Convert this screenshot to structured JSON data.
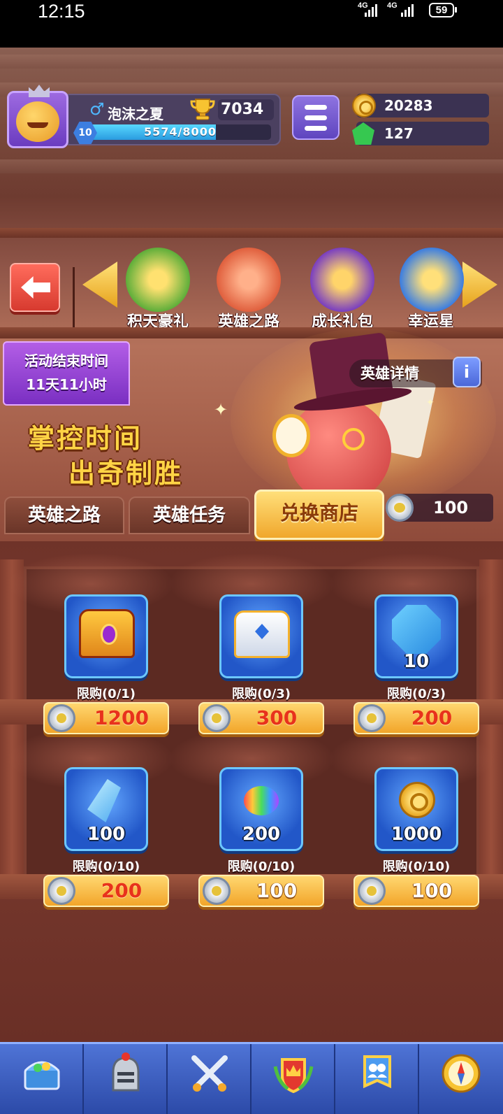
{
  "status_bar": {
    "time": "12:15",
    "network_1": "4G",
    "network_2": "4G",
    "battery": "59"
  },
  "profile": {
    "name": "泡沫之夏",
    "trophies": "7034",
    "level": "10",
    "xp_text": "5574/8000",
    "xp_progress": 0.697
  },
  "currencies": {
    "gold": "20283",
    "gems": "127"
  },
  "events": [
    {
      "label": "积天豪礼",
      "icon": "lucky-seven-icon",
      "color": "#5fae3a"
    },
    {
      "label": "英雄之路",
      "icon": "hero-clock-icon",
      "color": "#e0603e"
    },
    {
      "label": "成长礼包",
      "icon": "treasure-bag-icon",
      "color": "#7a3fc0"
    },
    {
      "label": "幸运星",
      "icon": "lucky-star-icon",
      "color": "#3c7ee0"
    }
  ],
  "banner": {
    "timer_line1": "活动结束时间",
    "timer_line2": "11天11小时",
    "slogan_line1": "掌控时间",
    "slogan_line2": "出奇制胜",
    "hero_details": "英雄详情",
    "info_glyph": "i"
  },
  "tabs": [
    {
      "label": "英雄之路"
    },
    {
      "label": "英雄任务"
    },
    {
      "label": "兑换商店",
      "active": true
    }
  ],
  "token_balance": "100",
  "shop_items": [
    {
      "icon": "golden-chest-icon",
      "qty": "",
      "limit": "限购(0/1)",
      "price": "1200",
      "price_color": "red"
    },
    {
      "icon": "winged-chest-icon",
      "qty": "",
      "limit": "限购(0/3)",
      "price": "300",
      "price_color": "red"
    },
    {
      "icon": "rune-stone-icon",
      "qty": "10",
      "limit": "限购(0/3)",
      "price": "200",
      "price_color": "red"
    },
    {
      "icon": "blue-crystal-icon",
      "qty": "100",
      "limit": "限购(0/10)",
      "price": "200",
      "price_color": "red"
    },
    {
      "icon": "rainbow-bean-icon",
      "qty": "200",
      "limit": "限购(0/10)",
      "price": "100",
      "price_color": "white"
    },
    {
      "icon": "gold-coin-icon",
      "qty": "1000",
      "limit": "限购(0/10)",
      "price": "100",
      "price_color": "white"
    }
  ],
  "bottom_nav": [
    {
      "icon": "treasure-chest-icon"
    },
    {
      "icon": "knight-helmet-icon"
    },
    {
      "icon": "crossed-swords-icon"
    },
    {
      "icon": "crown-shield-icon"
    },
    {
      "icon": "guild-banner-icon"
    },
    {
      "icon": "compass-icon"
    }
  ],
  "colors": {
    "accent_gold": "#f2a52a",
    "nav_blue": "#3c5cc0",
    "price_red": "#e8321c"
  }
}
